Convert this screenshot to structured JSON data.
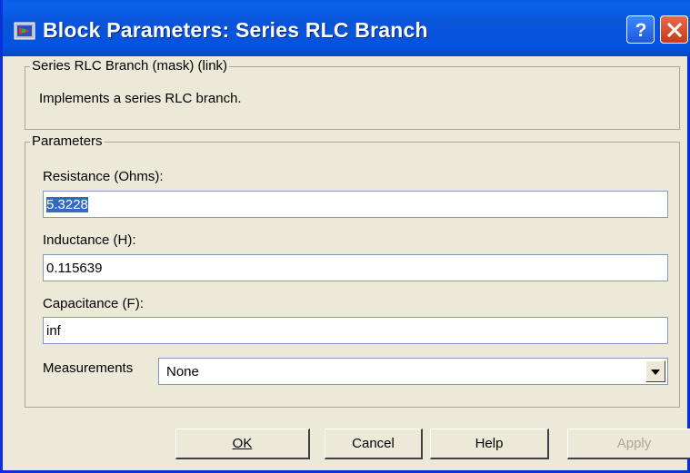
{
  "window": {
    "title": "Block Parameters: Series RLC Branch"
  },
  "mask": {
    "label": "Series RLC Branch (mask) (link)",
    "description": "Implements a series RLC branch."
  },
  "parameters": {
    "label": "Parameters",
    "resistance": {
      "label": "Resistance (Ohms):",
      "value": "5.3228"
    },
    "inductance": {
      "label": "Inductance (H):",
      "value": "0.115639"
    },
    "capacitance": {
      "label": "Capacitance (F):",
      "value": "inf"
    },
    "measurements": {
      "label": "Measurements",
      "value": "None"
    }
  },
  "buttons": {
    "ok": "OK",
    "cancel": "Cancel",
    "help": "Help",
    "apply": "Apply"
  },
  "icons": {
    "app_icon": "simulink-block-icon",
    "help": "question-mark-icon",
    "close": "close-x-icon",
    "dropdown": "chevron-down-icon"
  },
  "colors": {
    "title_bar": "#0a54d8",
    "close_button": "#d8502e",
    "dialog_bg": "#ece9d8",
    "selection": "#316ac5"
  }
}
